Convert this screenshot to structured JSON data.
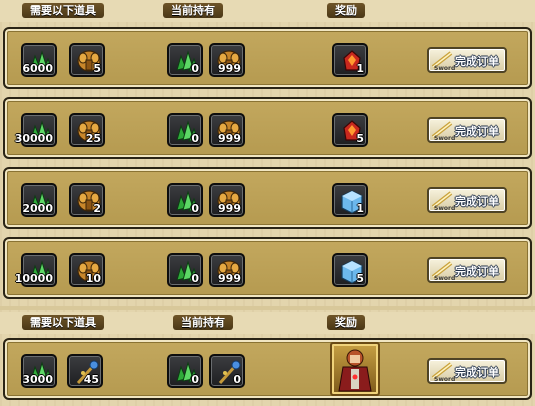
{
  "header_top": {
    "need": "需要以下道具",
    "have": "当前持有",
    "reward": "奖励"
  },
  "header_bottom": {
    "need": "需要以下道具",
    "have": "当前持有",
    "reward": "奖励"
  },
  "rows": [
    {
      "need1": "6000",
      "need2": "5",
      "have1": "0",
      "have2": "999",
      "reward": "1",
      "button": "完成订单",
      "button_sub": "Sword"
    },
    {
      "need1": "30000",
      "need2": "25",
      "have1": "0",
      "have2": "999",
      "reward": "5",
      "button": "完成订单",
      "button_sub": "Sword"
    },
    {
      "need1": "2000",
      "need2": "2",
      "have1": "0",
      "have2": "999",
      "reward": "1",
      "button": "完成订单",
      "button_sub": "Sword"
    },
    {
      "need1": "10000",
      "need2": "10",
      "have1": "0",
      "have2": "999",
      "reward": "5",
      "button": "完成订单",
      "button_sub": "Sword"
    },
    {
      "need1": "3000",
      "need2": "45",
      "have1": "0",
      "have2": "0",
      "reward": "",
      "button": "完成订单",
      "button_sub": "Sword"
    }
  ],
  "icons": {
    "item_a": "green-crystal-icon",
    "item_b_rows_1_4": "golden-armor-icon",
    "item_b_row_5": "staff-icon",
    "reward_rows_1_2": "red-gem-icon",
    "reward_rows_3_4": "blue-cube-icon",
    "reward_row_5": "hero-portrait-icon"
  }
}
